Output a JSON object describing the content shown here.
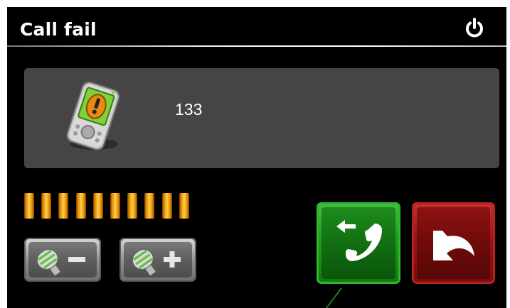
{
  "header": {
    "title": "Call fail"
  },
  "icons": {
    "power": "power-icon",
    "device": "phone-warning-icon",
    "volume_down": "microphone-minus-icon",
    "volume_up": "microphone-plus-icon",
    "redial": "redial-icon",
    "back": "back-arrow-icon"
  },
  "call": {
    "number": "133"
  },
  "volume": {
    "segments_lit": 10,
    "segments_total": 10
  },
  "colors": {
    "redial": "#1e8b1e",
    "back": "#8e1212",
    "level": "#f0a000"
  }
}
